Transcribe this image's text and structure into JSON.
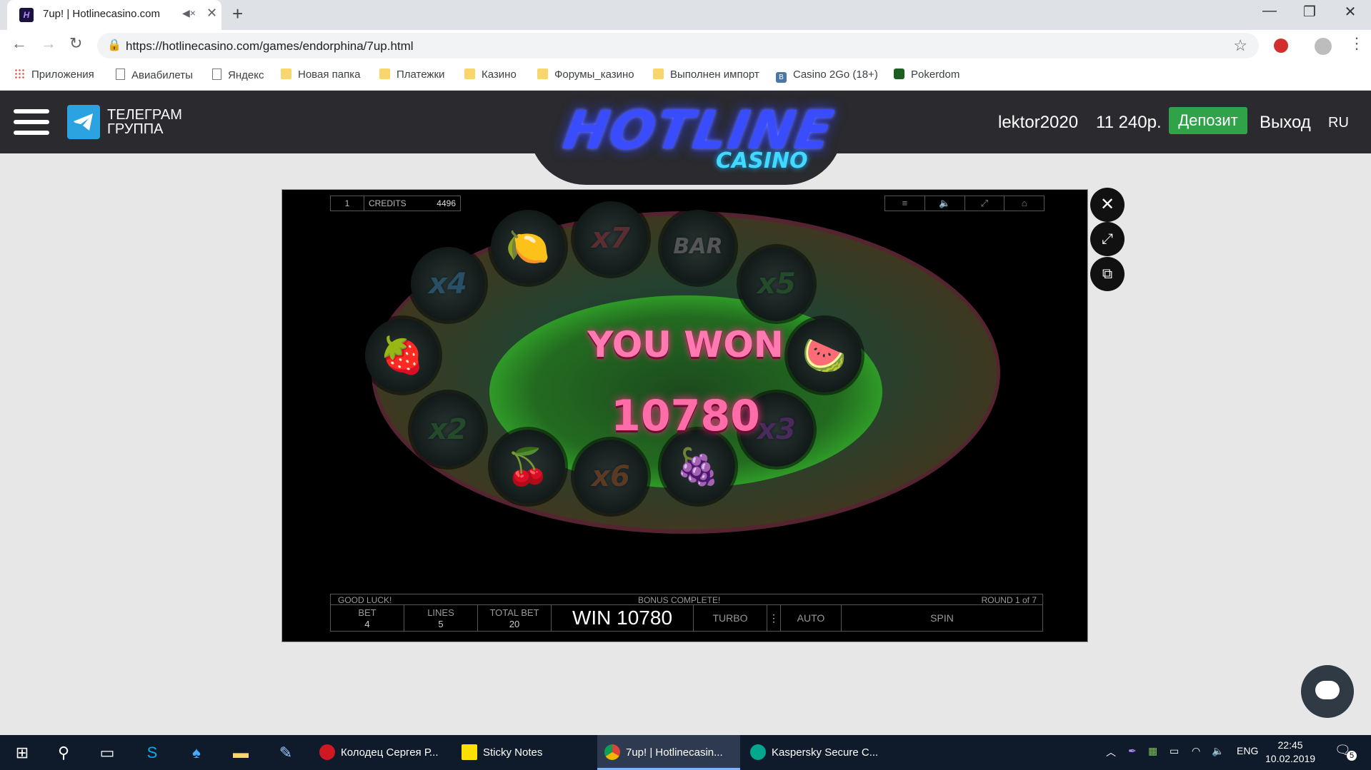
{
  "browser": {
    "tab_title": "7up! | Hotlinecasino.com",
    "url": "https://hotlinecasino.com/games/endorphina/7up.html",
    "bookmarks": [
      "Приложения",
      "Авиабилеты",
      "Яндекс",
      "Новая папка",
      "Платежки",
      "Казино",
      "Форумы_казино",
      "Выполнен импорт",
      "Casino 2Go (18+)",
      "Pokerdom"
    ]
  },
  "site": {
    "telegram_line1": "ТЕЛЕГРАМ",
    "telegram_line2": "ГРУППА",
    "logo_main": "HOTLINE",
    "logo_sub": "CASINO",
    "username": "lektor2020",
    "balance": "11 240р.",
    "deposit_label": "Депозит",
    "logout_label": "Выход",
    "language": "RU"
  },
  "game": {
    "top_num": "1",
    "credits_label": "CREDITS",
    "credits_value": "4496",
    "you_won": "YOU WON",
    "win_amount": "10780",
    "symbols": {
      "x7": "x7",
      "x4": "x4",
      "x5": "x5",
      "x2": "x2",
      "x3": "x3",
      "x6": "x6",
      "bar": "BAR"
    },
    "message_left": "GOOD LUCK!",
    "message_center": "BONUS COMPLETE!",
    "message_right": "ROUND 1 of 7",
    "bet_label": "BET",
    "bet_value": "4",
    "lines_label": "LINES",
    "lines_value": "5",
    "total_bet_label": "TOTAL BET",
    "total_bet_value": "20",
    "win_text": "WIN 10780",
    "turbo_label": "TURBO",
    "auto_label": "AUTO",
    "spin_label": "SPIN"
  },
  "taskbar": {
    "apps": [
      "Колодец Сергея Р...",
      "Sticky Notes",
      "7up! | Hotlinecasin...",
      "Kaspersky Secure C..."
    ],
    "language": "ENG",
    "time": "22:45",
    "date": "10.02.2019",
    "notifications": "5"
  },
  "colors": {
    "accent_green": "#30a34a",
    "header_bg": "#2a2a2f",
    "taskbar_bg": "#0f1a2b"
  }
}
